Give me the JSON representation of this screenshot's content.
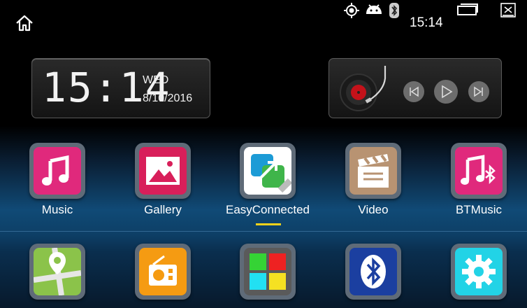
{
  "status_bar": {
    "home_icon": "home-icon",
    "icons": [
      "gps-icon",
      "android-debug-icon",
      "bluetooth-icon"
    ],
    "time": "15:14",
    "recent_apps_icon": "recent-apps-icon",
    "close_icon": "close-window-icon"
  },
  "clock_widget": {
    "time": "15:14",
    "day": "WED",
    "date": "8/10/2016"
  },
  "music_widget": {
    "controls": [
      "previous-icon",
      "play-icon",
      "next-icon"
    ]
  },
  "apps_row1": [
    {
      "label": "Music",
      "icon": "music-note-icon",
      "color": "#e0297c"
    },
    {
      "label": "Gallery",
      "icon": "gallery-icon",
      "color": "#d81f5a"
    },
    {
      "label": "EasyConnected",
      "icon": "easyconnected-icon",
      "color": "#ffffff"
    },
    {
      "label": "Video",
      "icon": "video-clapper-icon",
      "color": "#b89372"
    },
    {
      "label": "BTMusic",
      "icon": "bt-music-icon",
      "color": "#e0297c"
    }
  ],
  "apps_row2": [
    {
      "icon": "maps-icon",
      "color": "#8bc34a"
    },
    {
      "icon": "radio-icon",
      "color": "#f59b12"
    },
    {
      "icon": "apps-grid-icon",
      "color": "#5a5a5a"
    },
    {
      "icon": "bluetooth-app-icon",
      "color": "#1b3fa0"
    },
    {
      "icon": "settings-icon",
      "color": "#22d3e6"
    }
  ]
}
